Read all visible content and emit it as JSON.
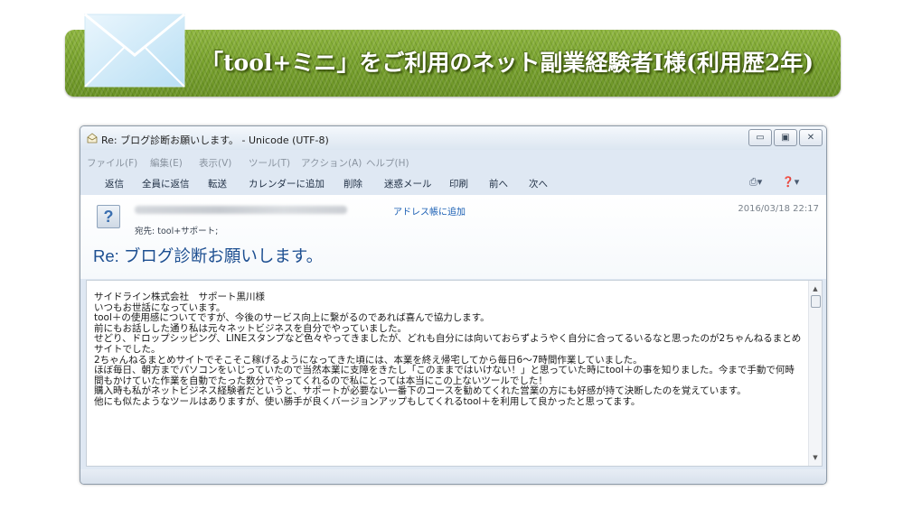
{
  "banner": {
    "title": "「tool+ミニ」をご利用のネット副業経験者I様(利用歴2年)"
  },
  "window": {
    "title": "Re: ブログ診断お願いします。 - Unicode (UTF-8)",
    "menu": [
      "ファイル(F)",
      "編集(E)",
      "表示(V)",
      "ツール(T)",
      "アクション(A)",
      "ヘルプ(H)"
    ],
    "toolbar": [
      "返信",
      "全員に返信",
      "転送",
      "カレンダーに追加",
      "削除",
      "迷惑メール",
      "印刷",
      "前へ",
      "次へ"
    ]
  },
  "header": {
    "avatar": "?",
    "add_to_contacts": "アドレス帳に追加",
    "date": "2016/03/18 22:17",
    "to_line": "宛先: tool+サポート;",
    "subject": "Re: ブログ診断お願いします。"
  },
  "body": {
    "text": "サイドライン株式会社　サポート黒川様\nいつもお世話になっています。\ntool＋の使用感についてですが、今後のサービス向上に繋がるのであれば喜んで協力します。\n前にもお話しした通り私は元々ネットビジネスを自分でやっていました。\nせどり、ドロップシッピング、LINEスタンプなど色々やってきましたが、どれも自分には向いておらずようやく自分に合ってるいるなと思ったのが2ちゃんねるまとめサイトでした。\n2ちゃんねるまとめサイトでそこそこ稼げるようになってきた頃には、本業を終え帰宅してから毎日6〜7時間作業していました。\nほぼ毎日、朝方までパソコンをいじっていたので当然本業に支障をきたし「このままではいけない！」と思っていた時にtool＋の事を知りました。今まで手動で何時間もかけていた作業を自動でたった数分でやってくれるので私にとっては本当にこの上ないツールでした！\n購入時も私がネットビジネス経験者だというと、サポートが必要ない一番下のコースを勧めてくれた営業の方にも好感が持て決断したのを覚えています。\n他にも似たようなツールはありますが、使い勝手が良くバージョンアップもしてくれるtool＋を利用して良かったと思ってます。"
  },
  "colors": {
    "banner_green": "#7aa32f",
    "subject_blue": "#1d4f91",
    "link_blue": "#1a5fb4"
  }
}
